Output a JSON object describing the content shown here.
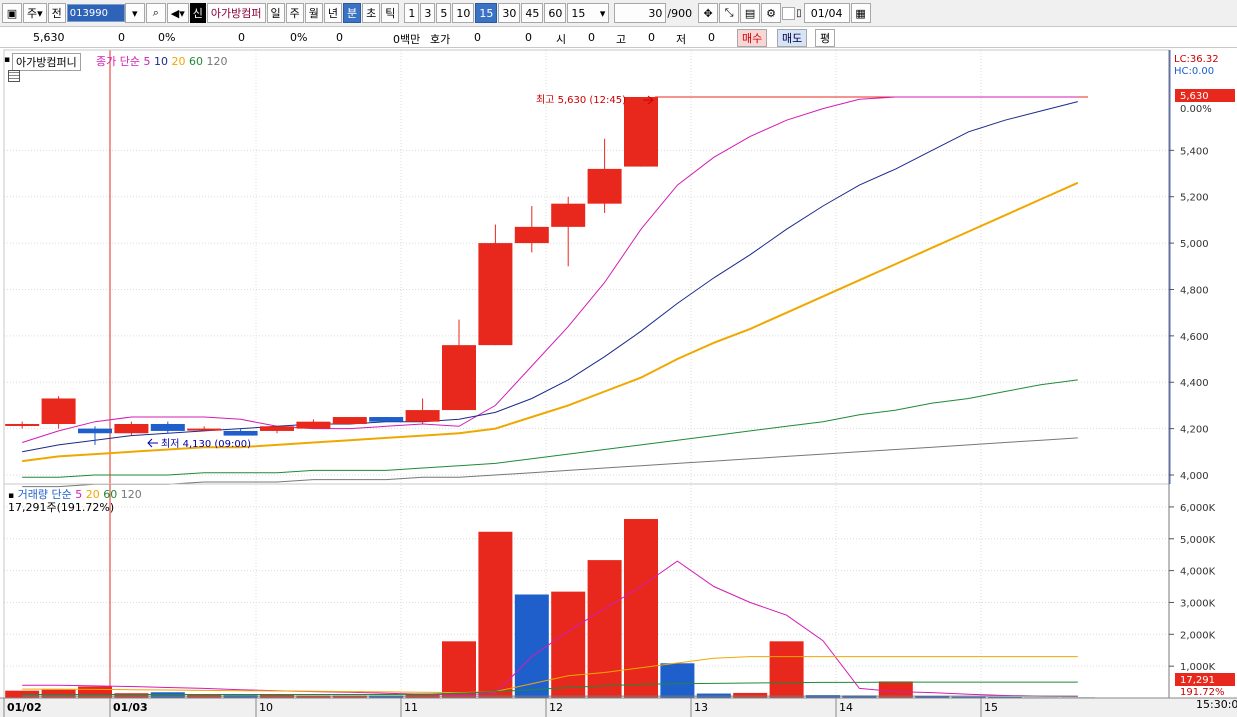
{
  "toolbar": {
    "mode_label": "주",
    "prev_label": "전",
    "code_value": "013990",
    "company_name": "아가방컴퍼",
    "new_label": "신",
    "periods": [
      "일",
      "주",
      "월",
      "년",
      "분",
      "초",
      "틱"
    ],
    "period_selected": "분",
    "intervals": [
      "1",
      "3",
      "5",
      "10",
      "15",
      "30",
      "45",
      "60"
    ],
    "interval_selected": "15",
    "interval_dropdown": "15",
    "page_count": "30",
    "page_total": "/900",
    "date_value": "01/04"
  },
  "quote": {
    "price": "5,630",
    "change": "0",
    "rate": "0%",
    "volume": "0",
    "vol_rate": "0%",
    "vol2": "0",
    "amount": "0백만",
    "hoga_label": "호가",
    "hoga1": "0",
    "hoga2": "0",
    "open_label": "시",
    "open_val": "0",
    "high_label": "고",
    "high_val": "0",
    "low_label": "저",
    "low_val": "0",
    "buy_button": "매수",
    "sell_button": "매도",
    "avg_label": "평"
  },
  "price_panel": {
    "stock_label": "아가방컴퍼니",
    "ma_title": "종가 단순",
    "ma_periods": [
      "5",
      "10",
      "20",
      "60",
      "120"
    ],
    "ma_colors": [
      "#d41cb4",
      "#1a2a8a",
      "#f0a800",
      "#1e8a3a",
      "#777777"
    ],
    "lc": "LC:36.32",
    "hc": "HC:0.00",
    "price_tag": "5,630",
    "rate_tag": "0.00%",
    "high_marker": "최고 5,630 (12:45)",
    "low_marker": "최저 4,130 (09:00)"
  },
  "volume_panel": {
    "title": "거래량 단순",
    "ma_periods": [
      "5",
      "20",
      "60",
      "120"
    ],
    "value_text": "17,291주(191.72%)",
    "vol_tag": "17,291",
    "vol_rate_tag": "191.72%"
  },
  "x_axis": {
    "date_labels": [
      "01/02",
      "01/03",
      "10",
      "11",
      "12",
      "13",
      "14",
      "15"
    ],
    "time_label": "15:30:00"
  },
  "colors": {
    "up": "#e8281c",
    "down": "#1e5fcc",
    "selected": "#3b73c4"
  },
  "chart_data": [
    {
      "type": "candlestick",
      "ylim": [
        4000,
        5630
      ],
      "y_ticks": [
        4000,
        4200,
        4400,
        4600,
        4800,
        5000,
        5200,
        5400
      ],
      "candles": [
        {
          "o": 4220,
          "h": 4230,
          "l": 4200,
          "c": 4220
        },
        {
          "o": 4220,
          "h": 4340,
          "l": 4200,
          "c": 4330
        },
        {
          "o": 4200,
          "h": 4210,
          "l": 4130,
          "c": 4180
        },
        {
          "o": 4180,
          "h": 4230,
          "l": 4170,
          "c": 4220
        },
        {
          "o": 4220,
          "h": 4230,
          "l": 4180,
          "c": 4190
        },
        {
          "o": 4200,
          "h": 4210,
          "l": 4190,
          "c": 4200
        },
        {
          "o": 4190,
          "h": 4200,
          "l": 4170,
          "c": 4170
        },
        {
          "o": 4190,
          "h": 4210,
          "l": 4180,
          "c": 4210
        },
        {
          "o": 4200,
          "h": 4240,
          "l": 4200,
          "c": 4230
        },
        {
          "o": 4220,
          "h": 4250,
          "l": 4220,
          "c": 4250
        },
        {
          "o": 4250,
          "h": 4250,
          "l": 4230,
          "c": 4230
        },
        {
          "o": 4230,
          "h": 4330,
          "l": 4220,
          "c": 4280
        },
        {
          "o": 4280,
          "h": 4670,
          "l": 4280,
          "c": 4560
        },
        {
          "o": 4560,
          "h": 5080,
          "l": 4560,
          "c": 5000
        },
        {
          "o": 5000,
          "h": 5160,
          "l": 4960,
          "c": 5070
        },
        {
          "o": 5070,
          "h": 5200,
          "l": 4900,
          "c": 5170
        },
        {
          "o": 5170,
          "h": 5450,
          "l": 5130,
          "c": 5320
        },
        {
          "o": 5330,
          "h": 5630,
          "l": 5330,
          "c": 5630
        },
        {
          "o": 5630,
          "h": 5630,
          "l": 5630,
          "c": 5630
        },
        {
          "o": 5630,
          "h": 5630,
          "l": 5630,
          "c": 5630
        },
        {
          "o": 5630,
          "h": 5630,
          "l": 5630,
          "c": 5630
        },
        {
          "o": 5630,
          "h": 5630,
          "l": 5630,
          "c": 5630
        },
        {
          "o": 5630,
          "h": 5630,
          "l": 5630,
          "c": 5630
        },
        {
          "o": 5630,
          "h": 5630,
          "l": 5630,
          "c": 5630
        },
        {
          "o": 5630,
          "h": 5630,
          "l": 5630,
          "c": 5630
        },
        {
          "o": 5630,
          "h": 5630,
          "l": 5630,
          "c": 5630
        },
        {
          "o": 5630,
          "h": 5630,
          "l": 5630,
          "c": 5630
        },
        {
          "o": 5630,
          "h": 5630,
          "l": 5630,
          "c": 5630
        },
        {
          "o": 5630,
          "h": 5630,
          "l": 5630,
          "c": 5630
        },
        {
          "o": 5630,
          "h": 5630,
          "l": 5630,
          "c": 5630
        }
      ],
      "ma": {
        "5": [
          4140,
          4190,
          4230,
          4250,
          4250,
          4250,
          4240,
          4210,
          4200,
          4200,
          4210,
          4220,
          4210,
          4300,
          4470,
          4640,
          4830,
          5060,
          5250,
          5370,
          5460,
          5530,
          5580,
          5620,
          5630,
          5630,
          5630,
          5630,
          5630,
          5630
        ],
        "10": [
          4100,
          4130,
          4150,
          4170,
          4180,
          4190,
          4200,
          4210,
          4220,
          4220,
          4230,
          4230,
          4240,
          4270,
          4330,
          4410,
          4510,
          4620,
          4740,
          4850,
          4950,
          5060,
          5160,
          5250,
          5320,
          5400,
          5480,
          5530,
          5570,
          5610
        ],
        "20": [
          4060,
          4080,
          4090,
          4100,
          4110,
          4120,
          4120,
          4130,
          4140,
          4150,
          4160,
          4170,
          4180,
          4200,
          4250,
          4300,
          4360,
          4420,
          4500,
          4570,
          4630,
          4700,
          4770,
          4840,
          4910,
          4980,
          5050,
          5120,
          5190,
          5260
        ],
        "60": [
          3990,
          3990,
          4000,
          4000,
          4000,
          4010,
          4010,
          4010,
          4020,
          4020,
          4020,
          4030,
          4040,
          4050,
          4070,
          4090,
          4110,
          4130,
          4150,
          4170,
          4190,
          4210,
          4230,
          4260,
          4280,
          4310,
          4330,
          4360,
          4390,
          4410
        ],
        "120": [
          3950,
          3950,
          3960,
          3960,
          3960,
          3970,
          3970,
          3970,
          3980,
          3980,
          3980,
          3990,
          3990,
          4000,
          4010,
          4020,
          4030,
          4040,
          4050,
          4060,
          4070,
          4080,
          4090,
          4100,
          4110,
          4120,
          4130,
          4140,
          4150,
          4160
        ]
      }
    },
    {
      "type": "bar",
      "title": "거래량",
      "ylim": [
        0,
        6000
      ],
      "y_ticks": [
        1000,
        2000,
        3000,
        4000,
        5000,
        6000
      ],
      "y_tick_labels": [
        "1,000K",
        "2,000K",
        "3,000K",
        "4,000K",
        "5,000K",
        "6,000K"
      ],
      "values": [
        230,
        260,
        360,
        150,
        180,
        120,
        90,
        100,
        80,
        80,
        80,
        140,
        1780,
        5220,
        3250,
        3340,
        4330,
        5620,
        1090,
        140,
        160,
        1780,
        90,
        80,
        520,
        60,
        40,
        30,
        20,
        20
      ],
      "up": [
        true,
        true,
        true,
        true,
        false,
        true,
        false,
        true,
        true,
        true,
        false,
        true,
        true,
        true,
        false,
        true,
        true,
        true,
        false,
        false,
        true,
        true,
        false,
        false,
        true,
        false,
        false,
        false,
        false,
        false
      ],
      "ma": {
        "5": [
          400,
          400,
          380,
          360,
          330,
          300,
          260,
          230,
          200,
          180,
          150,
          120,
          100,
          140,
          1300,
          2100,
          2800,
          3500,
          4300,
          3500,
          3000,
          2600,
          1800,
          300,
          200,
          170,
          120,
          80,
          60,
          50
        ],
        "20": [
          280,
          280,
          270,
          260,
          250,
          240,
          230,
          220,
          210,
          200,
          190,
          180,
          170,
          200,
          450,
          700,
          800,
          950,
          1100,
          1250,
          1300,
          1300,
          1300,
          1300,
          1300,
          1300,
          1300,
          1300,
          1300,
          1300
        ],
        "60": [
          110,
          110,
          110,
          110,
          110,
          110,
          110,
          110,
          110,
          110,
          110,
          120,
          150,
          200,
          260,
          330,
          380,
          430,
          450,
          460,
          470,
          480,
          490,
          490,
          500,
          500,
          500,
          500,
          500,
          500
        ],
        "120": [
          60,
          60,
          60,
          60,
          60,
          60,
          60,
          60,
          60,
          60,
          60,
          60,
          60,
          60,
          60,
          60,
          60,
          60,
          60,
          60,
          60,
          60,
          60,
          60,
          60,
          60,
          60,
          60,
          60,
          60
        ]
      }
    }
  ]
}
